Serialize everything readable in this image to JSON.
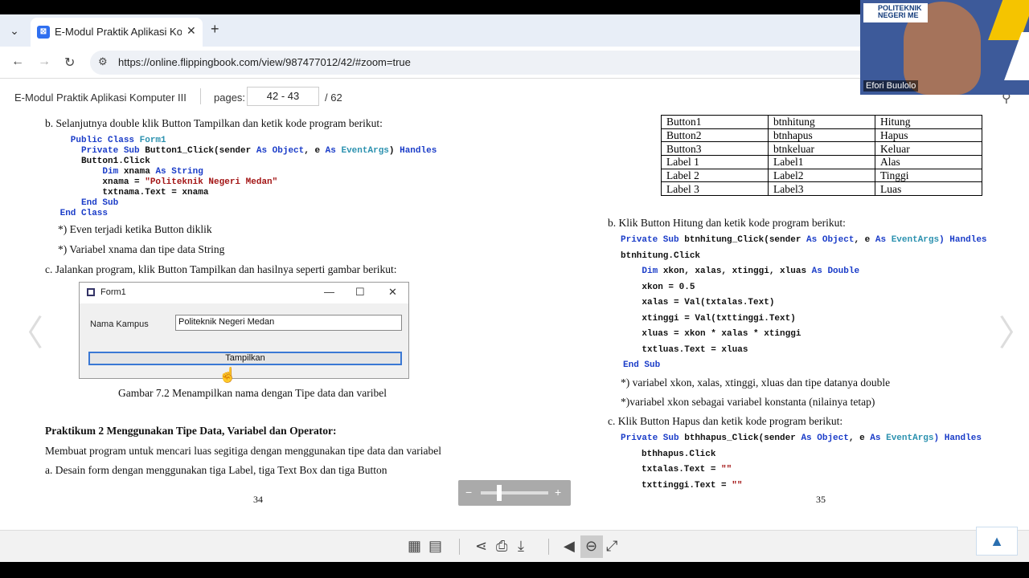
{
  "browser": {
    "tab_title": "E-Modul Praktik Aplikasi Kompu",
    "url": "https://online.flippingbook.com/view/987477012/42/#zoom=true"
  },
  "flipbook": {
    "title": "E-Modul Praktik Aplikasi Komputer III",
    "pages_label": "pages:",
    "pages_value": "42 - 43",
    "pages_total": "/ 62"
  },
  "left_page": {
    "step_b": "b.  Selanjutnya double klik Button Tampilkan dan ketik kode program berikut:",
    "code": [
      [
        "Public Class ",
        "Form1"
      ],
      [
        "  Private Sub ",
        "Button1_Click(sender ",
        "As Object",
        ", e ",
        "As ",
        "EventArgs",
        ") Handles"
      ],
      [
        "  Button1.Click"
      ],
      [
        "      Dim ",
        "xnama ",
        "As String"
      ],
      [
        "      xnama = ",
        "\"Politeknik Negeri Medan\""
      ],
      [
        "      txtnama.Text = xnama"
      ],
      [
        "  End Sub"
      ],
      [
        "End Class"
      ]
    ],
    "note1": "*) Even terjadi ketika Button diklik",
    "note2": "*) Variabel xnama dan tipe data String",
    "step_c": "c.  Jalankan program, klik Button Tampilkan dan hasilnya seperti gambar berikut:",
    "form": {
      "title": "Form1",
      "label": "Nama Kampus",
      "textbox": "Politeknik Negeri Medan",
      "button": "Tampilkan"
    },
    "caption": "Gambar 7.2 Menampilkan nama dengan Tipe data dan varibel",
    "section_title": "Praktikum 2 Menggunakan Tipe Data, Variabel dan Operator:",
    "section_desc": "Membuat program untuk mencari luas segitiga dengan menggunakan tipe data dan variabel",
    "step_a": "a.  Desain form dengan menggunakan tiga Label, tiga Text Box dan tiga Button",
    "page_number": "34"
  },
  "right_page": {
    "table": [
      [
        "Button1",
        "btnhitung",
        "Hitung"
      ],
      [
        "Button2",
        "btnhapus",
        "Hapus"
      ],
      [
        "Button3",
        "btnkeluar",
        "Keluar"
      ],
      [
        "Label 1",
        "Label1",
        "Alas"
      ],
      [
        "Label 2",
        "Label2",
        "Tinggi"
      ],
      [
        "Label 3",
        "Label3",
        "Luas"
      ]
    ],
    "step_b": "b.  Klik Button Hitung dan ketik kode program berikut:",
    "code_b_line1_a": "Private Sub ",
    "code_b_line1_b": "btnhitung_Click(sender ",
    "code_b_line1_c": "As Object",
    "code_b_line1_d": ", e ",
    "code_b_line1_e": "As ",
    "code_b_line1_f": "EventArgs",
    "code_b_line1_g": ") Handles",
    "code_b_line2": "btnhitung.Click",
    "code_b_line3_a": "    Dim ",
    "code_b_line3_b": "xkon, xalas, xtinggi, xluas ",
    "code_b_line3_c": "As Double",
    "code_b_rest": [
      "    xkon = 0.5",
      "    xalas = Val(txtalas.Text)",
      "    xtinggi = Val(txttinggi.Text)",
      "    xluas = xkon * xalas * xtinggi",
      "    txtluas.Text = xluas"
    ],
    "code_b_end": "End Sub",
    "note1": "*) variabel xkon, xalas, xtinggi, xluas dan tipe datanya double",
    "note2": "*)variabel xkon sebagai variabel konstanta (nilainya tetap)",
    "step_c": "c.  Klik Button Hapus dan ketik kode program berikut:",
    "code_c_line1_a": "Private Sub ",
    "code_c_line1_b": "bthhapus_Click(sender ",
    "code_c_line1_c": "As Object",
    "code_c_line1_d": ", e ",
    "code_c_line1_e": "As ",
    "code_c_line1_f": "EventArgs",
    "code_c_line1_g": ") Handles",
    "code_c_line2": "bthhapus.Click",
    "code_c_line3_a": "txtalas.Text = ",
    "code_c_line3_b": "\"\"",
    "code_c_line4_a": "txttinggi.Text = ",
    "code_c_line4_b": "\"\"",
    "page_number": "35"
  },
  "video": {
    "logo_text_1": "POLITEKNIK",
    "logo_text_2": "NEGERI ME",
    "name": "Efori Buulolo"
  },
  "icons": {
    "prev": "chevron-left-icon",
    "next": "chevron-right-icon"
  }
}
